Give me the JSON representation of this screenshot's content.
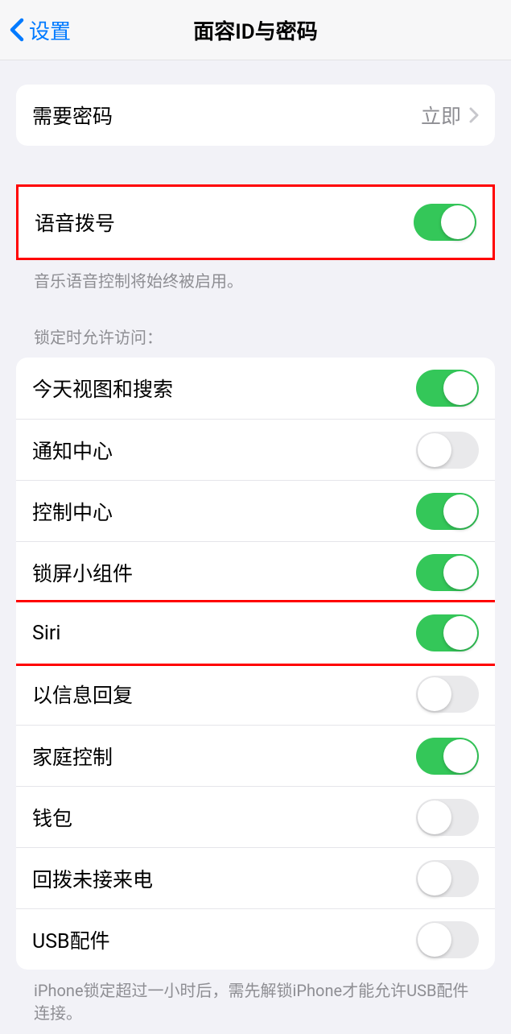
{
  "header": {
    "back_label": "设置",
    "title": "面容ID与密码"
  },
  "section1": {
    "require_passcode_label": "需要密码",
    "require_passcode_value": "立即"
  },
  "section2": {
    "voice_dial_label": "语音拨号",
    "voice_dial_on": true,
    "footer": "音乐语音控制将始终被启用。"
  },
  "section3": {
    "header": "锁定时允许访问：",
    "items": [
      {
        "label": "今天视图和搜索",
        "on": true
      },
      {
        "label": "通知中心",
        "on": false
      },
      {
        "label": "控制中心",
        "on": true
      },
      {
        "label": "锁屏小组件",
        "on": true
      },
      {
        "label": "Siri",
        "on": true
      },
      {
        "label": "以信息回复",
        "on": false
      },
      {
        "label": "家庭控制",
        "on": true
      },
      {
        "label": "钱包",
        "on": false
      },
      {
        "label": "回拨未接来电",
        "on": false
      },
      {
        "label": "USB配件",
        "on": false
      }
    ],
    "footer": "iPhone锁定超过一小时后，需先解锁iPhone才能允许USB配件连接。"
  }
}
